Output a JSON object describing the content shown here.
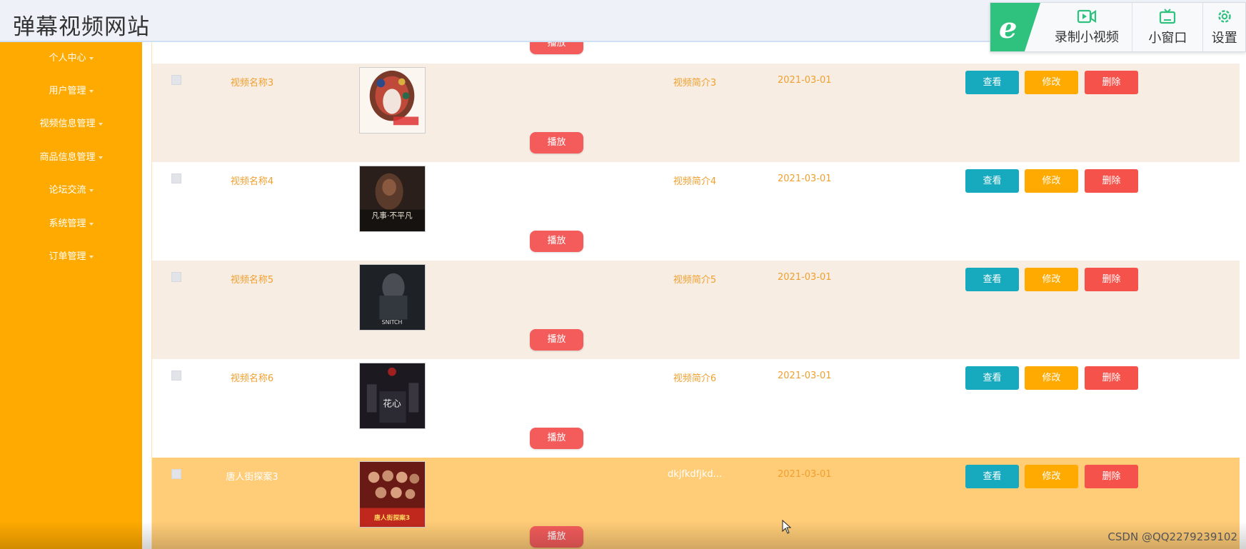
{
  "header": {
    "title": "弹幕视频网站"
  },
  "toolbar": {
    "logo": "e",
    "record_label": "录制小视频",
    "mini_label": "小窗口",
    "settings_label": "设置"
  },
  "sidebar": {
    "items": [
      {
        "label": "个人中心"
      },
      {
        "label": "用户管理"
      },
      {
        "label": "视频信息管理"
      },
      {
        "label": "商品信息管理"
      },
      {
        "label": "论坛交流"
      },
      {
        "label": "系统管理"
      },
      {
        "label": "订单管理"
      }
    ]
  },
  "table": {
    "play_label": "播放",
    "view_label": "查看",
    "edit_label": "修改",
    "delete_label": "删除",
    "rows": [
      {
        "name": "视频名称3",
        "intro": "视频简介3",
        "date": "2021-03-01"
      },
      {
        "name": "视频名称4",
        "intro": "视频简介4",
        "date": "2021-03-01"
      },
      {
        "name": "视频名称5",
        "intro": "视频简介5",
        "date": "2021-03-01"
      },
      {
        "name": "视频名称6",
        "intro": "视频简介6",
        "date": "2021-03-01"
      },
      {
        "name": "唐人街探案3",
        "intro": "dkjfkdfjkd...",
        "date": "2021-03-01"
      }
    ]
  },
  "thumb_text": {
    "row2": "凡事·不平凡",
    "row3": "SNITCH",
    "row4": "花心",
    "row5": "唐人街探案3"
  },
  "watermark": "CSDN @QQ2279239102"
}
